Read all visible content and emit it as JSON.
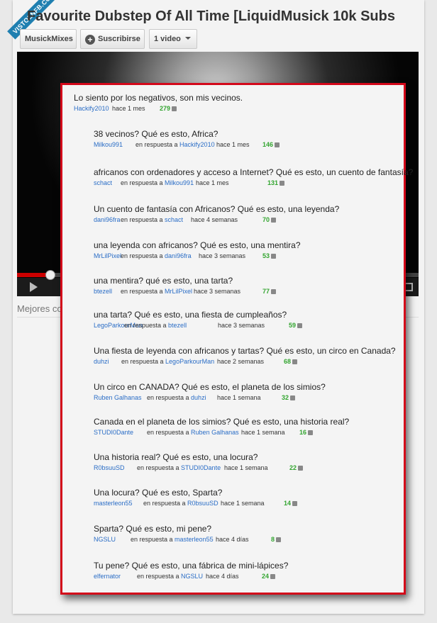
{
  "watermark": "VISTOENFB.COM",
  "video": {
    "title": "Favourite Dubstep Of All Time [LiquidMusick 10k Subs",
    "channel": "MusickMixes",
    "subscribe_label": "Suscribirse",
    "video_count": "1 video",
    "below_label": "Mejores co"
  },
  "comments": [
    {
      "text": "Lo siento por los negativos, son mis vecinos.",
      "author": "Hackify2010",
      "reply_to": "",
      "time": "hace 1 mes",
      "likes": "279"
    },
    {
      "text": "38 vecinos? Qué es esto, Africa?",
      "author": "Milkou991",
      "reply_to": "Hackify2010",
      "time": "hace 1 mes",
      "likes": "146"
    },
    {
      "text": "africanos con ordenadores y acceso a Internet? Qué es esto, un cuento de fantasía?",
      "author": "schact",
      "reply_to": "Milkou991",
      "time": "hace 1 mes",
      "likes": "131"
    },
    {
      "text": "Un cuento de fantasía con Africanos? Qué es esto, una leyenda?",
      "author": "dani96fra",
      "reply_to": "schact",
      "time": "hace 4 semanas",
      "likes": "70"
    },
    {
      "text": "una leyenda con africanos? Qué es esto, una mentira?",
      "author": "MrLilPixel",
      "reply_to": "dani96fra",
      "time": "hace 3 semanas",
      "likes": "53"
    },
    {
      "text": "una mentira? qué es esto, una tarta?",
      "author": "btezell",
      "reply_to": "MrLilPixel",
      "time": "hace 3 semanas",
      "likes": "77"
    },
    {
      "text": "una tarta? Qué es esto, una fiesta de cumpleaños?",
      "author": "LegoParkourMan",
      "reply_to": "btezell",
      "time": "hace 3 semanas",
      "likes": "59"
    },
    {
      "text": "Una fiesta de leyenda con africanos y tartas? Qué es esto, un circo en Canada?",
      "author": "duhzi",
      "reply_to": "LegoParkourMan",
      "time": "hace 2 semanas",
      "likes": "68"
    },
    {
      "text": "Un circo en CANADA? Qué es esto, el planeta de los simios?",
      "author": "Ruben Galhanas",
      "reply_to": "duhzi",
      "time": "hace 1 semana",
      "likes": "32"
    },
    {
      "text": "Canada en el planeta de los simios? Qué es esto, una historia real?",
      "author": "STUDI0Dante",
      "reply_to": "Ruben Galhanas",
      "time": "hace 1 semana",
      "likes": "16"
    },
    {
      "text": "Una historia real? Qué es esto, una locura?",
      "author": "R0bsuuSD",
      "reply_to": "STUDI0Dante",
      "time": "hace 1 semana",
      "likes": "22"
    },
    {
      "text": "Una locura? Qué es esto, Sparta?",
      "author": "masterleon55",
      "reply_to": "R0bsuuSD",
      "time": "hace 1 semana",
      "likes": "14"
    },
    {
      "text": "Sparta? Qué es esto, mi pene?",
      "author": "NGSLU",
      "reply_to": "masterleon55",
      "time": "hace 4 días",
      "likes": "8"
    },
    {
      "text": "Tu pene? Qué es esto, una fábrica de mini-lápices?",
      "author": "elfernator",
      "reply_to": "NGSLU",
      "time": "hace 4 días",
      "likes": "24"
    }
  ],
  "reply_prefix": "en respuesta a"
}
